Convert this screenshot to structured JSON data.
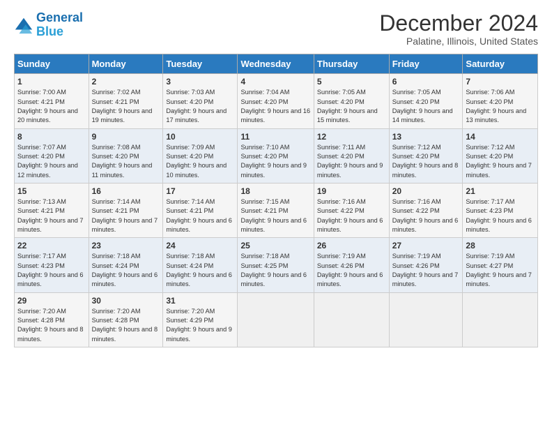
{
  "logo": {
    "line1": "General",
    "line2": "Blue"
  },
  "title": "December 2024",
  "location": "Palatine, Illinois, United States",
  "weekdays": [
    "Sunday",
    "Monday",
    "Tuesday",
    "Wednesday",
    "Thursday",
    "Friday",
    "Saturday"
  ],
  "weeks": [
    [
      {
        "day": "1",
        "sunrise": "7:00 AM",
        "sunset": "4:21 PM",
        "daylight": "9 hours and 20 minutes."
      },
      {
        "day": "2",
        "sunrise": "7:02 AM",
        "sunset": "4:21 PM",
        "daylight": "9 hours and 19 minutes."
      },
      {
        "day": "3",
        "sunrise": "7:03 AM",
        "sunset": "4:20 PM",
        "daylight": "9 hours and 17 minutes."
      },
      {
        "day": "4",
        "sunrise": "7:04 AM",
        "sunset": "4:20 PM",
        "daylight": "9 hours and 16 minutes."
      },
      {
        "day": "5",
        "sunrise": "7:05 AM",
        "sunset": "4:20 PM",
        "daylight": "9 hours and 15 minutes."
      },
      {
        "day": "6",
        "sunrise": "7:05 AM",
        "sunset": "4:20 PM",
        "daylight": "9 hours and 14 minutes."
      },
      {
        "day": "7",
        "sunrise": "7:06 AM",
        "sunset": "4:20 PM",
        "daylight": "9 hours and 13 minutes."
      }
    ],
    [
      {
        "day": "8",
        "sunrise": "7:07 AM",
        "sunset": "4:20 PM",
        "daylight": "9 hours and 12 minutes."
      },
      {
        "day": "9",
        "sunrise": "7:08 AM",
        "sunset": "4:20 PM",
        "daylight": "9 hours and 11 minutes."
      },
      {
        "day": "10",
        "sunrise": "7:09 AM",
        "sunset": "4:20 PM",
        "daylight": "9 hours and 10 minutes."
      },
      {
        "day": "11",
        "sunrise": "7:10 AM",
        "sunset": "4:20 PM",
        "daylight": "9 hours and 9 minutes."
      },
      {
        "day": "12",
        "sunrise": "7:11 AM",
        "sunset": "4:20 PM",
        "daylight": "9 hours and 9 minutes."
      },
      {
        "day": "13",
        "sunrise": "7:12 AM",
        "sunset": "4:20 PM",
        "daylight": "9 hours and 8 minutes."
      },
      {
        "day": "14",
        "sunrise": "7:12 AM",
        "sunset": "4:20 PM",
        "daylight": "9 hours and 7 minutes."
      }
    ],
    [
      {
        "day": "15",
        "sunrise": "7:13 AM",
        "sunset": "4:21 PM",
        "daylight": "9 hours and 7 minutes."
      },
      {
        "day": "16",
        "sunrise": "7:14 AM",
        "sunset": "4:21 PM",
        "daylight": "9 hours and 7 minutes."
      },
      {
        "day": "17",
        "sunrise": "7:14 AM",
        "sunset": "4:21 PM",
        "daylight": "9 hours and 6 minutes."
      },
      {
        "day": "18",
        "sunrise": "7:15 AM",
        "sunset": "4:21 PM",
        "daylight": "9 hours and 6 minutes."
      },
      {
        "day": "19",
        "sunrise": "7:16 AM",
        "sunset": "4:22 PM",
        "daylight": "9 hours and 6 minutes."
      },
      {
        "day": "20",
        "sunrise": "7:16 AM",
        "sunset": "4:22 PM",
        "daylight": "9 hours and 6 minutes."
      },
      {
        "day": "21",
        "sunrise": "7:17 AM",
        "sunset": "4:23 PM",
        "daylight": "9 hours and 6 minutes."
      }
    ],
    [
      {
        "day": "22",
        "sunrise": "7:17 AM",
        "sunset": "4:23 PM",
        "daylight": "9 hours and 6 minutes."
      },
      {
        "day": "23",
        "sunrise": "7:18 AM",
        "sunset": "4:24 PM",
        "daylight": "9 hours and 6 minutes."
      },
      {
        "day": "24",
        "sunrise": "7:18 AM",
        "sunset": "4:24 PM",
        "daylight": "9 hours and 6 minutes."
      },
      {
        "day": "25",
        "sunrise": "7:18 AM",
        "sunset": "4:25 PM",
        "daylight": "9 hours and 6 minutes."
      },
      {
        "day": "26",
        "sunrise": "7:19 AM",
        "sunset": "4:26 PM",
        "daylight": "9 hours and 6 minutes."
      },
      {
        "day": "27",
        "sunrise": "7:19 AM",
        "sunset": "4:26 PM",
        "daylight": "9 hours and 7 minutes."
      },
      {
        "day": "28",
        "sunrise": "7:19 AM",
        "sunset": "4:27 PM",
        "daylight": "9 hours and 7 minutes."
      }
    ],
    [
      {
        "day": "29",
        "sunrise": "7:20 AM",
        "sunset": "4:28 PM",
        "daylight": "9 hours and 8 minutes."
      },
      {
        "day": "30",
        "sunrise": "7:20 AM",
        "sunset": "4:28 PM",
        "daylight": "9 hours and 8 minutes."
      },
      {
        "day": "31",
        "sunrise": "7:20 AM",
        "sunset": "4:29 PM",
        "daylight": "9 hours and 9 minutes."
      },
      null,
      null,
      null,
      null
    ]
  ]
}
